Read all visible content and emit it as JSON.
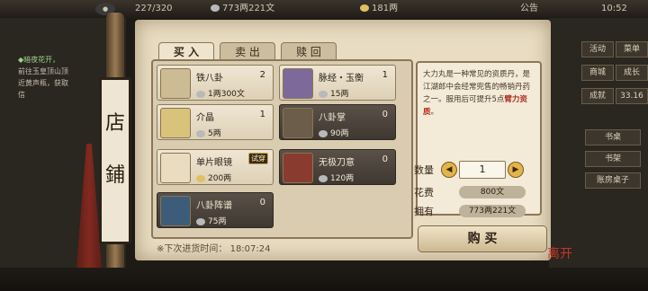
{
  "topbar": {
    "counter": "227/320",
    "copper": "773两221文",
    "silver": "181两",
    "notice": "公告",
    "time": "10:52"
  },
  "quest": {
    "title": "◆暗夜花开，",
    "lines": [
      "前往玉皇顶山顶",
      "近黄声瓶，获取",
      "信"
    ]
  },
  "sidebar": {
    "buttons": [
      "活动",
      "菜单",
      "商城",
      "成长",
      "成就",
      "33.16"
    ],
    "tabs": [
      "书桌",
      "书架",
      "账房桌子"
    ]
  },
  "sign": {
    "chars": [
      "店",
      "鋪"
    ]
  },
  "tabs": {
    "buy": "买 入",
    "sell": "卖 出",
    "redeem": "赎 回"
  },
  "items": [
    {
      "name": "铁八卦",
      "qty": "2",
      "price": "1两300文",
      "tag": "",
      "style": "light"
    },
    {
      "name": "脉经・玉衡",
      "qty": "1",
      "price": "15两",
      "tag": "",
      "style": "light"
    },
    {
      "name": "介晶",
      "qty": "1",
      "price": "5两",
      "tag": "",
      "style": "light"
    },
    {
      "name": "八卦掌",
      "qty": "0",
      "price": "90两",
      "tag": "",
      "style": "dark"
    },
    {
      "name": "单片眼镜",
      "qty": "0",
      "price": "200两",
      "tag": "试穿",
      "style": "light"
    },
    {
      "name": "无极刀意",
      "qty": "0",
      "price": "120两",
      "tag": "",
      "style": "dark"
    },
    {
      "name": "八卦阵谱",
      "qty": "0",
      "price": "75两",
      "tag": "",
      "style": "light"
    }
  ],
  "restock": {
    "label": "※下次进货时间：",
    "time": "18:07:24"
  },
  "detail": {
    "desc": "大力丸是一种常见的资质丹，是江湖郎中会经常兜售的畅销丹药之一。服用后可提升5点",
    "desc_em": "臂力资质",
    "desc_end": "。",
    "qty_label": "数量",
    "qty_value": "1",
    "cost_label": "花费",
    "cost_value": "800文",
    "own_label": "拥有",
    "own_value": "773两221文",
    "buy_label": "购 买"
  },
  "seal": "离开",
  "colors": {
    "paper": "#e8dcc2",
    "accent_red": "#b02d1c",
    "dark_card": "#4a4239"
  }
}
